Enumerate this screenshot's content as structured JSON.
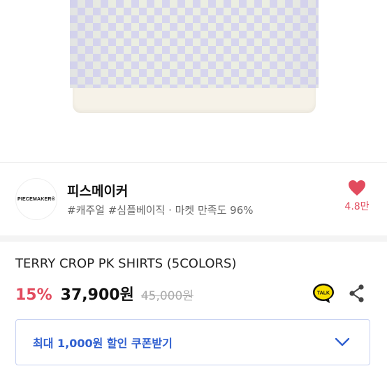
{
  "brand": {
    "logo_text": "PIECEMAKER®",
    "name": "피스메이커",
    "tags": "#캐주얼 #심플베이직 · 마켓 만족도 96%",
    "likes": "4.8만"
  },
  "product": {
    "title": "TERRY CROP PK SHIRTS (5COLORS)",
    "discount": "15%",
    "price": "37,900원",
    "original_price": "45,000원"
  },
  "actions": {
    "talk_label": "TALK"
  },
  "coupon": {
    "label": "최대 1,000원 할인 쿠폰받기"
  },
  "colors": {
    "accent_red": "#e24b5e",
    "accent_blue": "#2f5fd0",
    "talk_yellow": "#f9e000"
  },
  "icons": [
    "heart-icon",
    "kakao-talk-icon",
    "share-icon",
    "chevron-down-icon"
  ]
}
